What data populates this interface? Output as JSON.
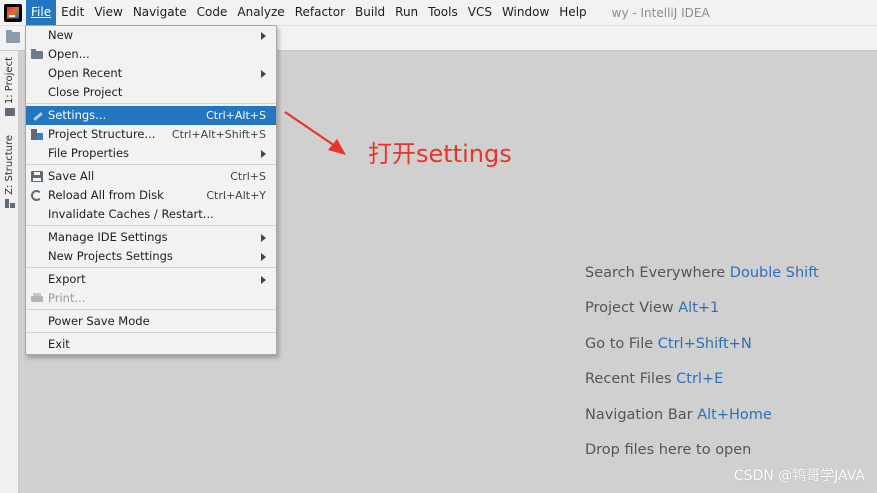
{
  "menubar": {
    "items": [
      {
        "label": "File",
        "active": true
      },
      {
        "label": "Edit"
      },
      {
        "label": "View"
      },
      {
        "label": "Navigate"
      },
      {
        "label": "Code"
      },
      {
        "label": "Analyze"
      },
      {
        "label": "Refactor"
      },
      {
        "label": "Build"
      },
      {
        "label": "Run"
      },
      {
        "label": "Tools"
      },
      {
        "label": "VCS"
      },
      {
        "label": "Window"
      },
      {
        "label": "Help"
      }
    ],
    "window_title": "wy - IntelliJ IDEA"
  },
  "left_strip": {
    "project_tab": "1: Project",
    "structure_tab": "Z: Structure"
  },
  "file_menu": {
    "new": "New",
    "open": "Open...",
    "open_recent": "Open Recent",
    "close_project": "Close Project",
    "settings": "Settings...",
    "settings_shortcut": "Ctrl+Alt+S",
    "project_structure": "Project Structure...",
    "project_structure_shortcut": "Ctrl+Alt+Shift+S",
    "file_properties": "File Properties",
    "save_all": "Save All",
    "save_all_shortcut": "Ctrl+S",
    "reload": "Reload All from Disk",
    "reload_shortcut": "Ctrl+Alt+Y",
    "invalidate": "Invalidate Caches / Restart...",
    "manage_ide": "Manage IDE Settings",
    "new_projects": "New Projects Settings",
    "export": "Export",
    "print": "Print...",
    "power_save": "Power Save Mode",
    "exit": "Exit"
  },
  "annotation": {
    "text": "打开settings",
    "color": "#e8342b"
  },
  "hints": [
    {
      "text": "Search Everywhere",
      "key": "Double Shift"
    },
    {
      "text": "Project View",
      "key": "Alt+1"
    },
    {
      "text": "Go to File",
      "key": "Ctrl+Shift+N"
    },
    {
      "text": "Recent Files",
      "key": "Ctrl+E"
    },
    {
      "text": "Navigation Bar",
      "key": "Alt+Home"
    },
    {
      "text": "Drop files here to open",
      "key": ""
    }
  ],
  "watermark": "CSDN @鸨哥学JAVA",
  "colors": {
    "accent": "#2675bf",
    "background": "#d0d0d0",
    "hint_key": "#2f6fb3"
  }
}
